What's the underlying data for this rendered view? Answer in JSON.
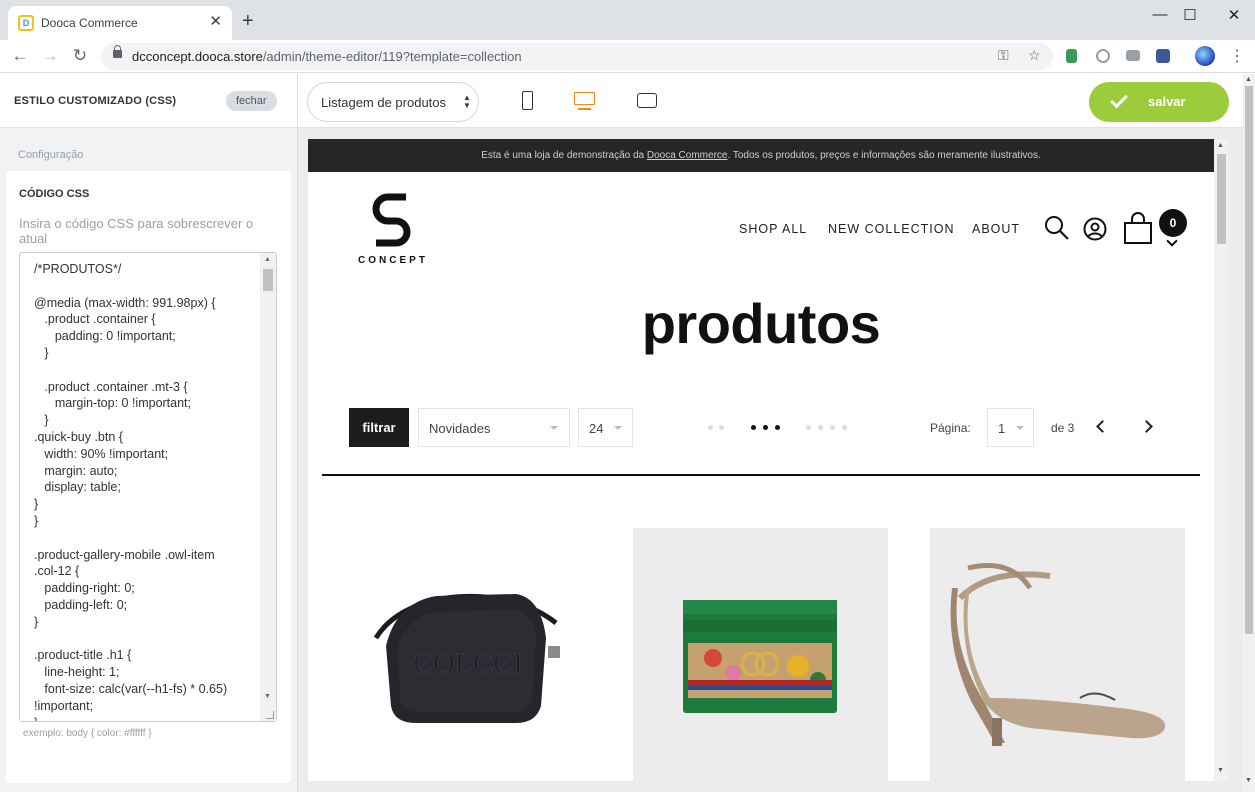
{
  "browser": {
    "tab_title": "Dooca Commerce",
    "url_host": "dcconcept.dooca.store",
    "url_path": "/admin/theme-editor/119?template=collection"
  },
  "left_panel": {
    "title": "ESTILO CUSTOMIZADO (CSS)",
    "close_label": "fechar",
    "section_label": "Configuração",
    "card_title": "CÓDIGO CSS",
    "help_text": "Insira o código CSS para sobrescrever o atual",
    "css_code": "/*PRODUTOS*/\n\n@media (max-width: 991.98px) {\n   .product .container {\n      padding: 0 !important;\n   }\n\n   .product .container .mt-3 {\n      margin-top: 0 !important;\n   }\n.quick-buy .btn {\n   width: 90% !important;\n   margin: auto;\n   display: table;\n}\n}\n\n.product-gallery-mobile .owl-item\n.col-12 {\n   padding-right: 0;\n   padding-left: 0;\n}\n\n.product-title .h1 {\n   line-height: 1;\n   font-size: calc(var(--h1-fs) * 0.65)\n!important;\n}",
    "example_text": "exemplo: body { color: #ffffff }"
  },
  "topbar": {
    "template_select": "Listagem de produtos",
    "save_label": "salvar",
    "accent_color": "#9ccb3b",
    "active_device": "desktop"
  },
  "store": {
    "announcement_pre": "Esta é uma loja de demonstração da ",
    "announcement_link": "Dooca Commerce",
    "announcement_post": ". Todos os produtos, preços e informações são meramente ilustrativos.",
    "logo_text": "CONCEPT",
    "nav": [
      "SHOP ALL",
      "NEW COLLECTION",
      "ABOUT"
    ],
    "cart_count": "0",
    "page_title": "produtos",
    "filter_label": "filtrar",
    "sort_value": "Novidades",
    "per_page_value": "24",
    "page_label": "Página:",
    "page_value": "1",
    "page_total": "de 3",
    "grid_options": [
      "2-columns",
      "3-columns",
      "4-columns"
    ],
    "grid_active": "3-columns",
    "products": [
      {
        "name": "black-crossbody-bag",
        "bg": "#ffffff"
      },
      {
        "name": "green-gg-card-holder",
        "bg": "#ececec"
      },
      {
        "name": "taupe-ankle-strap-pump",
        "bg": "#ececec"
      }
    ]
  }
}
